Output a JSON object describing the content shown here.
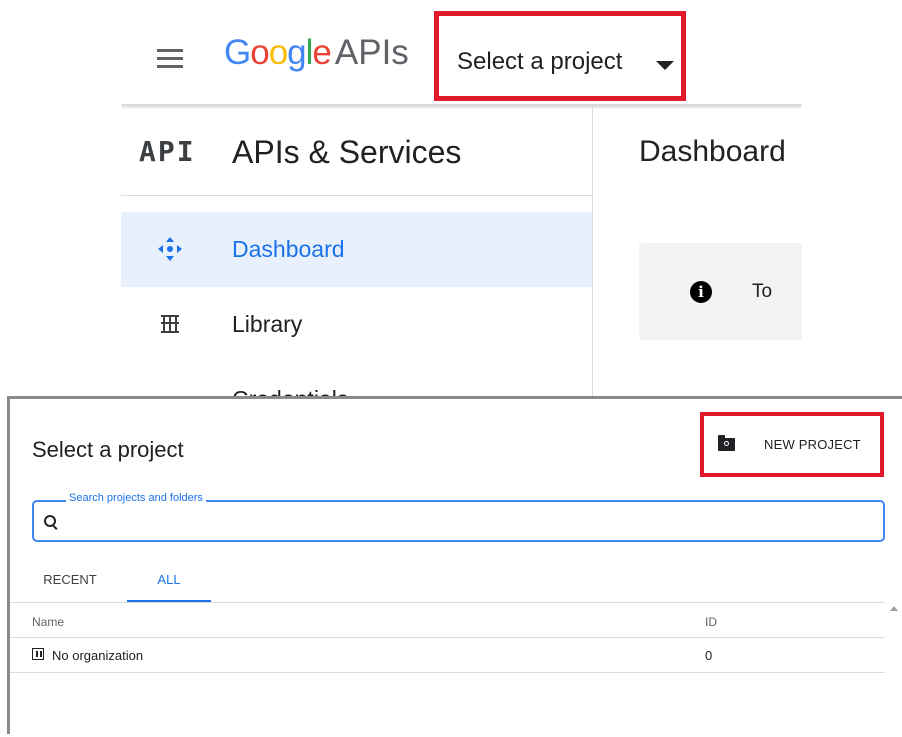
{
  "header": {
    "brand_letters": [
      "G",
      "o",
      "o",
      "g",
      "l",
      "e"
    ],
    "brand_suffix": "APIs",
    "project_selector_label": "Select a project"
  },
  "sidebar": {
    "logo_text": "API",
    "title": "APIs & Services",
    "items": [
      {
        "label": "Dashboard",
        "icon": "dashboard-icon",
        "active": true
      },
      {
        "label": "Library",
        "icon": "library-icon",
        "active": false
      },
      {
        "label": "Credentials",
        "icon": "credentials-icon",
        "active": false
      }
    ]
  },
  "main": {
    "title": "Dashboard",
    "info_text": "To"
  },
  "dialog": {
    "title": "Select a project",
    "new_project_label": "NEW PROJECT",
    "search_label": "Search projects and folders",
    "search_value": "",
    "tabs": [
      {
        "label": "RECENT",
        "active": false
      },
      {
        "label": "ALL",
        "active": true
      }
    ],
    "columns": {
      "name": "Name",
      "id": "ID"
    },
    "rows": [
      {
        "name": "No organization",
        "id": "0"
      }
    ]
  },
  "colors": {
    "highlight_red": "#e0192b",
    "accent_blue": "#1a73e8",
    "active_bg": "#e8f0fe"
  }
}
